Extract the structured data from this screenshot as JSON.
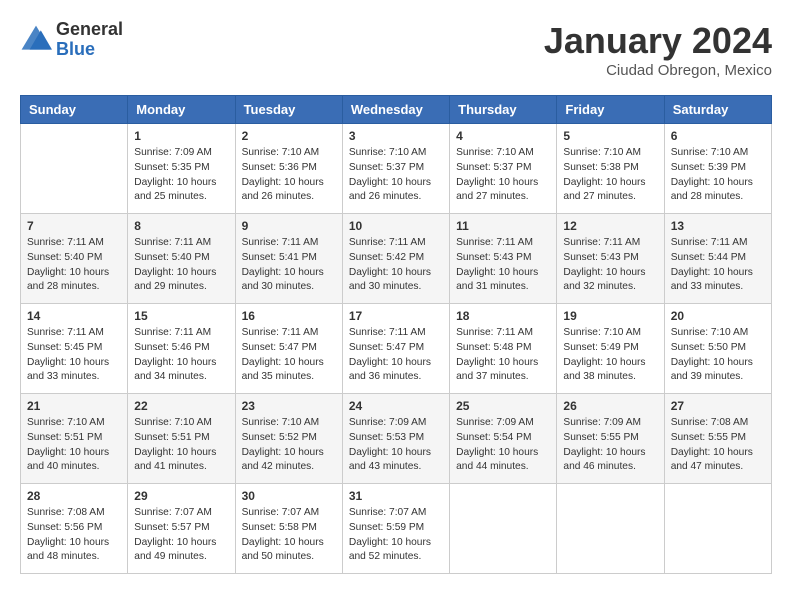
{
  "header": {
    "logo_line1": "General",
    "logo_line2": "Blue",
    "month": "January 2024",
    "location": "Ciudad Obregon, Mexico"
  },
  "days_of_week": [
    "Sunday",
    "Monday",
    "Tuesday",
    "Wednesday",
    "Thursday",
    "Friday",
    "Saturday"
  ],
  "weeks": [
    [
      {
        "day": "",
        "sunrise": "",
        "sunset": "",
        "daylight": ""
      },
      {
        "day": "1",
        "sunrise": "7:09 AM",
        "sunset": "5:35 PM",
        "daylight": "10 hours and 25 minutes."
      },
      {
        "day": "2",
        "sunrise": "7:10 AM",
        "sunset": "5:36 PM",
        "daylight": "10 hours and 26 minutes."
      },
      {
        "day": "3",
        "sunrise": "7:10 AM",
        "sunset": "5:37 PM",
        "daylight": "10 hours and 26 minutes."
      },
      {
        "day": "4",
        "sunrise": "7:10 AM",
        "sunset": "5:37 PM",
        "daylight": "10 hours and 27 minutes."
      },
      {
        "day": "5",
        "sunrise": "7:10 AM",
        "sunset": "5:38 PM",
        "daylight": "10 hours and 27 minutes."
      },
      {
        "day": "6",
        "sunrise": "7:10 AM",
        "sunset": "5:39 PM",
        "daylight": "10 hours and 28 minutes."
      }
    ],
    [
      {
        "day": "7",
        "sunrise": "7:11 AM",
        "sunset": "5:40 PM",
        "daylight": "10 hours and 28 minutes."
      },
      {
        "day": "8",
        "sunrise": "7:11 AM",
        "sunset": "5:40 PM",
        "daylight": "10 hours and 29 minutes."
      },
      {
        "day": "9",
        "sunrise": "7:11 AM",
        "sunset": "5:41 PM",
        "daylight": "10 hours and 30 minutes."
      },
      {
        "day": "10",
        "sunrise": "7:11 AM",
        "sunset": "5:42 PM",
        "daylight": "10 hours and 30 minutes."
      },
      {
        "day": "11",
        "sunrise": "7:11 AM",
        "sunset": "5:43 PM",
        "daylight": "10 hours and 31 minutes."
      },
      {
        "day": "12",
        "sunrise": "7:11 AM",
        "sunset": "5:43 PM",
        "daylight": "10 hours and 32 minutes."
      },
      {
        "day": "13",
        "sunrise": "7:11 AM",
        "sunset": "5:44 PM",
        "daylight": "10 hours and 33 minutes."
      }
    ],
    [
      {
        "day": "14",
        "sunrise": "7:11 AM",
        "sunset": "5:45 PM",
        "daylight": "10 hours and 33 minutes."
      },
      {
        "day": "15",
        "sunrise": "7:11 AM",
        "sunset": "5:46 PM",
        "daylight": "10 hours and 34 minutes."
      },
      {
        "day": "16",
        "sunrise": "7:11 AM",
        "sunset": "5:47 PM",
        "daylight": "10 hours and 35 minutes."
      },
      {
        "day": "17",
        "sunrise": "7:11 AM",
        "sunset": "5:47 PM",
        "daylight": "10 hours and 36 minutes."
      },
      {
        "day": "18",
        "sunrise": "7:11 AM",
        "sunset": "5:48 PM",
        "daylight": "10 hours and 37 minutes."
      },
      {
        "day": "19",
        "sunrise": "7:10 AM",
        "sunset": "5:49 PM",
        "daylight": "10 hours and 38 minutes."
      },
      {
        "day": "20",
        "sunrise": "7:10 AM",
        "sunset": "5:50 PM",
        "daylight": "10 hours and 39 minutes."
      }
    ],
    [
      {
        "day": "21",
        "sunrise": "7:10 AM",
        "sunset": "5:51 PM",
        "daylight": "10 hours and 40 minutes."
      },
      {
        "day": "22",
        "sunrise": "7:10 AM",
        "sunset": "5:51 PM",
        "daylight": "10 hours and 41 minutes."
      },
      {
        "day": "23",
        "sunrise": "7:10 AM",
        "sunset": "5:52 PM",
        "daylight": "10 hours and 42 minutes."
      },
      {
        "day": "24",
        "sunrise": "7:09 AM",
        "sunset": "5:53 PM",
        "daylight": "10 hours and 43 minutes."
      },
      {
        "day": "25",
        "sunrise": "7:09 AM",
        "sunset": "5:54 PM",
        "daylight": "10 hours and 44 minutes."
      },
      {
        "day": "26",
        "sunrise": "7:09 AM",
        "sunset": "5:55 PM",
        "daylight": "10 hours and 46 minutes."
      },
      {
        "day": "27",
        "sunrise": "7:08 AM",
        "sunset": "5:55 PM",
        "daylight": "10 hours and 47 minutes."
      }
    ],
    [
      {
        "day": "28",
        "sunrise": "7:08 AM",
        "sunset": "5:56 PM",
        "daylight": "10 hours and 48 minutes."
      },
      {
        "day": "29",
        "sunrise": "7:07 AM",
        "sunset": "5:57 PM",
        "daylight": "10 hours and 49 minutes."
      },
      {
        "day": "30",
        "sunrise": "7:07 AM",
        "sunset": "5:58 PM",
        "daylight": "10 hours and 50 minutes."
      },
      {
        "day": "31",
        "sunrise": "7:07 AM",
        "sunset": "5:59 PM",
        "daylight": "10 hours and 52 minutes."
      },
      {
        "day": "",
        "sunrise": "",
        "sunset": "",
        "daylight": ""
      },
      {
        "day": "",
        "sunrise": "",
        "sunset": "",
        "daylight": ""
      },
      {
        "day": "",
        "sunrise": "",
        "sunset": "",
        "daylight": ""
      }
    ]
  ]
}
